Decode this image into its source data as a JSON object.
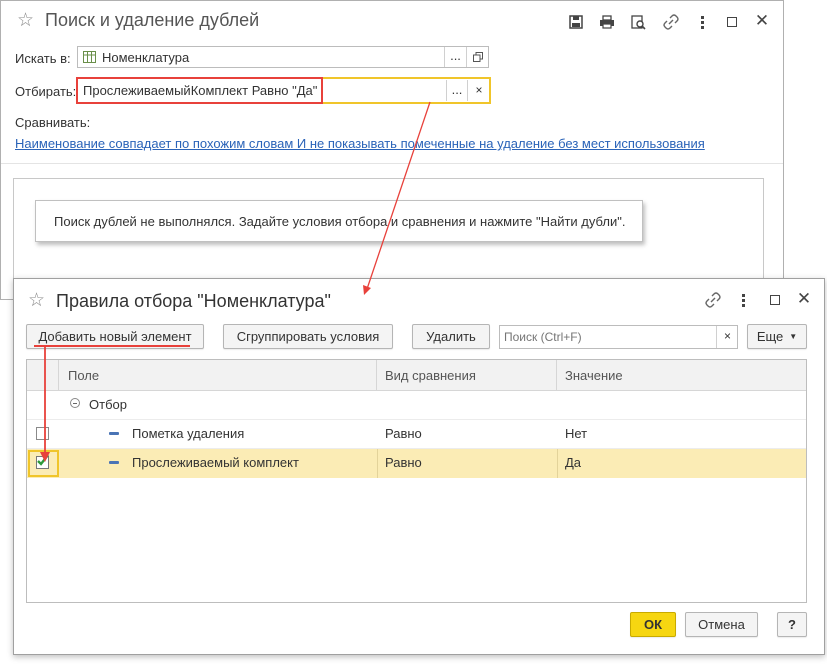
{
  "main_window": {
    "title": "Поиск и удаление дублей",
    "search_in_label": "Искать в:",
    "search_in_value": "Номенклатура",
    "filter_label": "Отбирать:",
    "filter_value": "ПрослеживаемыйКомплект Равно \"Да\"",
    "compare_label": "Сравнивать:",
    "compare_link": "Наименование совпадает по похожим словам И не показывать помеченные на удаление без мест использования",
    "message": "Поиск дублей не выполнялся.  Задайте условия отбора и сравнения и нажмите \"Найти дубли\".",
    "ellipsis": "...",
    "clear_symbol": "×"
  },
  "dialog": {
    "title": "Правила отбора \"Номенклатура\"",
    "toolbar": {
      "add_label": "Добавить новый элемент",
      "group_label": "Сгруппировать условия",
      "delete_label": "Удалить",
      "search_placeholder": "Поиск (Ctrl+F)",
      "more_label": "Еще"
    },
    "columns": [
      "Поле",
      "Вид сравнения",
      "Значение"
    ],
    "group_row": "Отбор",
    "rows": [
      {
        "field": "Пометка удаления",
        "comparison": "Равно",
        "value": "Нет",
        "checked": false
      },
      {
        "field": "Прослеживаемый комплект",
        "comparison": "Равно",
        "value": "Да",
        "checked": true
      }
    ],
    "ok_label": "ОК",
    "cancel_label": "Отмена",
    "help_label": "?"
  },
  "colors": {
    "highlight_red": "#e8413b",
    "selected_row": "#fbecb5",
    "ok_button": "#f6d611",
    "link": "#2a63b8"
  },
  "icons": [
    "star-icon",
    "save-icon",
    "print-icon",
    "preview-icon",
    "link-icon",
    "more-icon",
    "minimize-icon",
    "close-icon",
    "table-icon",
    "open-icon",
    "chevron-down-icon",
    "minus-icon"
  ]
}
